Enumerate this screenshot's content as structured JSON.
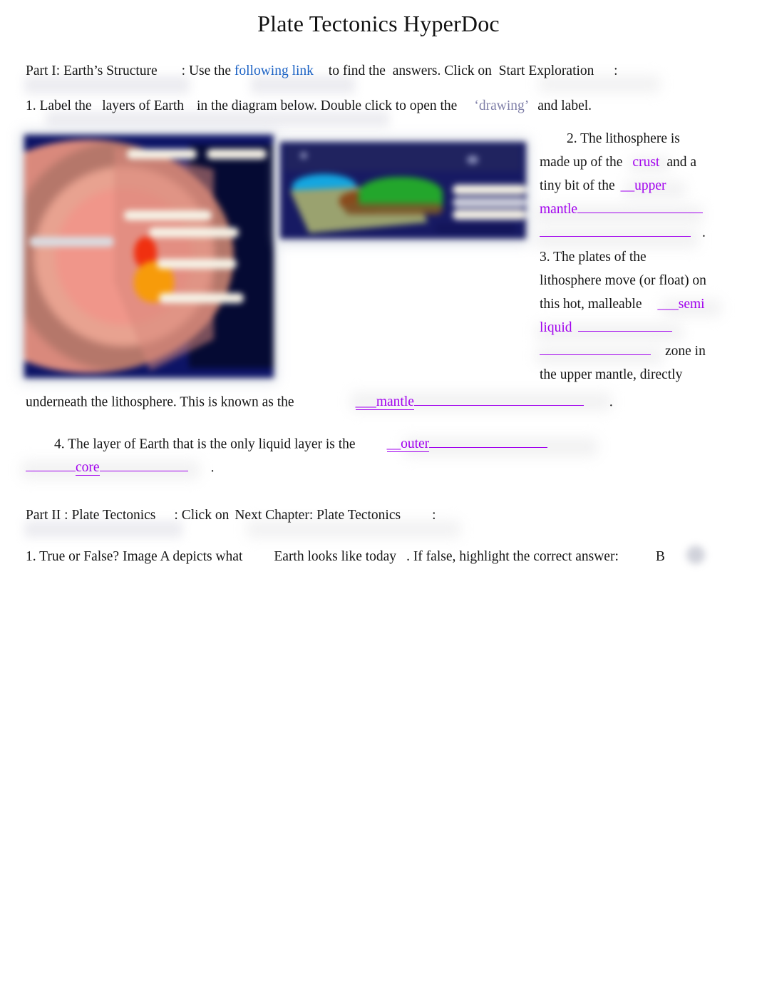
{
  "document": {
    "title": "Plate Tectonics HyperDoc"
  },
  "part1": {
    "heading": "Part I: Earth’s Structure",
    "instr_a": ": Use the ",
    "link_label": "following link",
    "instr_b": " to find the  answers. Click on ",
    "cta_label": " Start Exploration ",
    "instr_c": " :"
  },
  "q1": {
    "text_a": "1. Label the   layers of Earth",
    "text_b": "in the diagram below. Double click to open the",
    "drawing_label": "‘drawing’",
    "text_c": "and label."
  },
  "q2": {
    "line1": "2. The lithosphere is",
    "line2_a": "made up of the",
    "answer_crust": "crust",
    "line2_b": "and a",
    "line3_a": "tiny bit of the",
    "answer_upper": "__upper",
    "answer_mantle": "mantle",
    "period": "."
  },
  "q3": {
    "line1": "3. The plates of the",
    "line2": "lithosphere move (or float) on",
    "line3_a": "this hot, malleable",
    "answer_semi": "___semi",
    "answer_liquid": "liquid",
    "line4_b": "zone in",
    "line5": "the upper mantle, directly",
    "line6": "underneath the lithosphere. This is known as the",
    "answer_mantle2": "___mantle",
    "period": "."
  },
  "q4": {
    "text": "4. The layer of Earth that is the only liquid layer is the",
    "answer_outer": "__outer",
    "answer_core": "core",
    "answer_core_prefix": "_______",
    "period": "."
  },
  "part2": {
    "heading": "Part II : Plate Tectonics",
    "instr_a": ": Click on",
    "cta_label": "Next Chapter: Plate Tectonics",
    "instr_b": ":"
  },
  "q5": {
    "text_a": "1. True or False? Image A depicts what",
    "highlight": "Earth looks like today",
    "text_b": ". If false, highlight the correct answer:",
    "answer_b": "B"
  },
  "figures": {
    "earth_diagram": "earth-layers-cross-section-diagram",
    "terrain_diagram": "plate-tectonics-terrain-cross-section-diagram"
  },
  "colors": {
    "answer_purple": "#a100ee",
    "hyperlink_blue": "#1a61c4",
    "drawing_slate": "#7f7fa8",
    "text_black": "#151515"
  }
}
